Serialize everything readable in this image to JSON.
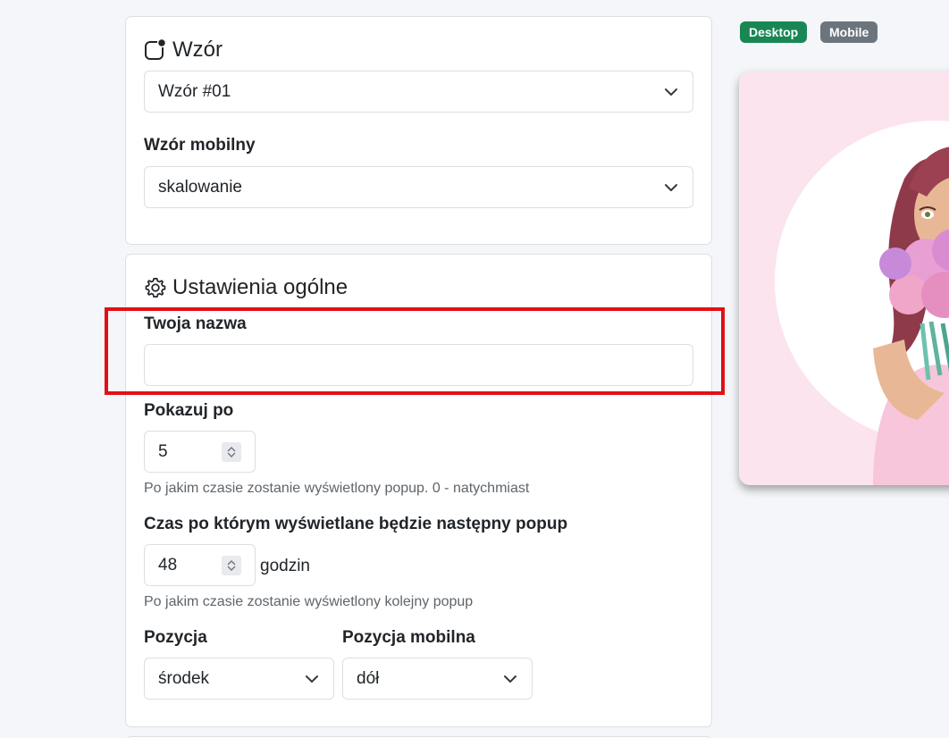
{
  "pattern_card": {
    "title": "Wzór",
    "pattern_select": {
      "value": "Wzór #01"
    },
    "mobile_label": "Wzór mobilny",
    "mobile_select": {
      "value": "skalowanie"
    }
  },
  "general_card": {
    "title": "Ustawienia ogólne",
    "name_label": "Twoja nazwa",
    "name_input": {
      "value": "",
      "placeholder": ""
    },
    "show_after_label": "Pokazuj po",
    "show_after_value": "5",
    "show_after_help": "Po jakim czasie zostanie wyświetlony popup. 0 - natychmiast",
    "next_popup_label": "Czas po którym wyświetlane będzie następny popup",
    "next_popup_value": "48",
    "next_popup_suffix": "godzin",
    "next_popup_help": "Po jakim czasie zostanie wyświetlony kolejny popup",
    "position_label": "Pozycja",
    "position_select": {
      "value": "środek"
    },
    "mobile_position_label": "Pozycja mobilna",
    "mobile_position_select": {
      "value": "dół"
    }
  },
  "preview": {
    "desktop_badge": "Desktop",
    "mobile_badge": "Mobile"
  },
  "colors": {
    "highlight": "#e30f16",
    "desktop_badge": "#198754",
    "mobile_badge": "#6c757d",
    "preview_bg": "#fbe4ee"
  },
  "icons": {
    "pattern": "pattern-icon",
    "settings": "gear-icon",
    "dropdown": "chevron-down-icon",
    "spinner": "spinner-arrows-icon"
  }
}
